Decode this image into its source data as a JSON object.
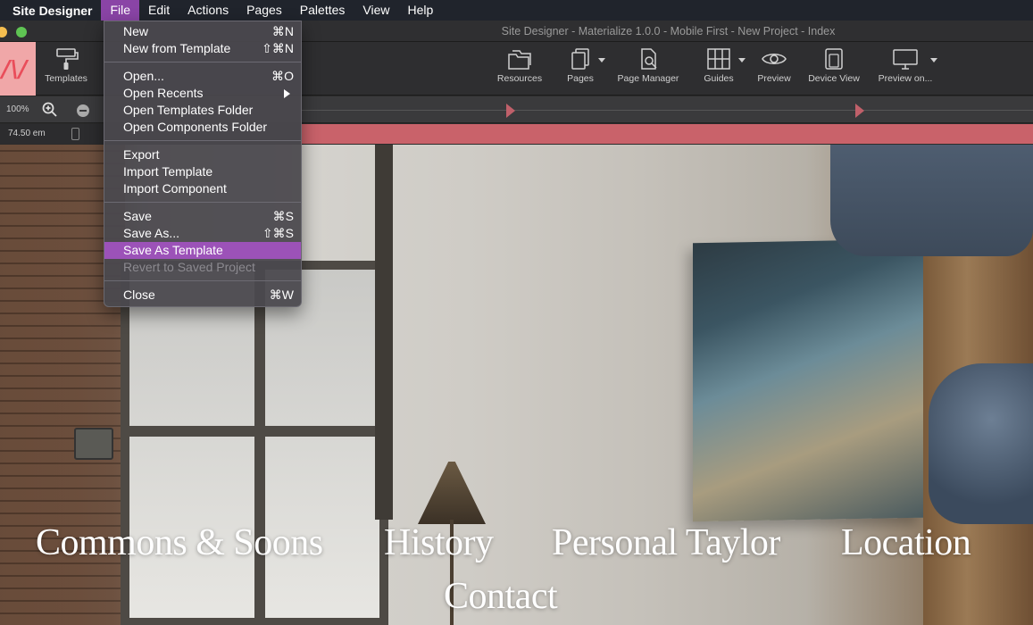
{
  "menubar": {
    "app_name": "Site Designer",
    "items": [
      "File",
      "Edit",
      "Actions",
      "Pages",
      "Palettes",
      "View",
      "Help"
    ]
  },
  "window": {
    "title": "Site Designer - Materialize 1.0.0 - Mobile First - New Project - Index"
  },
  "toolbar": {
    "templates": "Templates",
    "resources": "Resources",
    "pages": "Pages",
    "page_manager": "Page Manager",
    "guides": "Guides",
    "preview": "Preview",
    "device_view": "Device View",
    "preview_on": "Preview on..."
  },
  "zoom": {
    "value": "100%"
  },
  "width": {
    "value": "74.50 em"
  },
  "file_menu": {
    "groups": [
      [
        {
          "label": "New",
          "shortcut": "⌘N"
        },
        {
          "label": "New from Template",
          "shortcut": "⇧⌘N"
        }
      ],
      [
        {
          "label": "Open...",
          "shortcut": "⌘O"
        },
        {
          "label": "Open Recents",
          "shortcut": ""
        },
        {
          "label": "Open Templates Folder",
          "shortcut": ""
        },
        {
          "label": "Open Components Folder",
          "shortcut": ""
        }
      ],
      [
        {
          "label": "Export",
          "shortcut": ""
        },
        {
          "label": "Import Template",
          "shortcut": ""
        },
        {
          "label": "Import Component",
          "shortcut": ""
        }
      ],
      [
        {
          "label": "Save",
          "shortcut": "⌘S"
        },
        {
          "label": "Save As...",
          "shortcut": "⇧⌘S"
        },
        {
          "label": "Save As Template",
          "shortcut": ""
        },
        {
          "label": "Revert to Saved Project",
          "shortcut": ""
        }
      ],
      [
        {
          "label": "Close",
          "shortcut": "⌘W"
        }
      ]
    ],
    "highlighted": "Save As Template",
    "disabled": "Revert to Saved Project"
  },
  "site_nav": {
    "links": [
      "Commons & Soons",
      "History",
      "Personal Taylor",
      "Location",
      "Contact"
    ]
  },
  "colors": {
    "menu_highlight": "#9c52b8",
    "breakpoint_bar": "#c9626a",
    "logo_tile": "#f0a7a8"
  }
}
